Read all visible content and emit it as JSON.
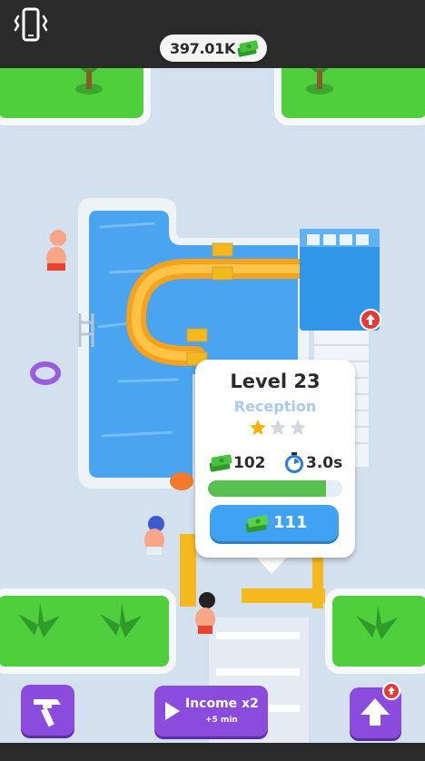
{
  "header": {
    "money": "397.01K",
    "vibration_icon": "phone-vibrate-icon",
    "cash_icon": "cash-stack-icon"
  },
  "popup": {
    "level": "Level 23",
    "station": "Reception",
    "stars_filled": 1,
    "stars_total": 3,
    "income": "102",
    "time": "3.0s",
    "progress": 0.88,
    "upgrade_cost": "111"
  },
  "bottom": {
    "build_icon": "hammer-icon",
    "income_title": "Income x2",
    "income_duration": "+5 min",
    "upgrade_icon": "upload-arrow-icon"
  },
  "colors": {
    "grass": "#4fcf3c",
    "pool": "#4aa4ef",
    "slide": "#f7a21b",
    "button_purple": "#8b4bdc",
    "upgrade_blue": "#3fa2f2",
    "progress_green": "#56c14d",
    "star_gold": "#f6b400"
  }
}
